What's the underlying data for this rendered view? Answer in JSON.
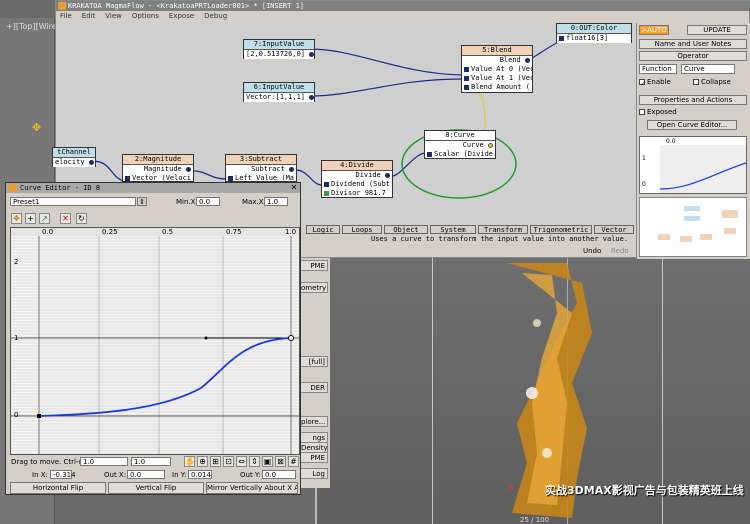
{
  "viewport": {
    "label": "+][Top][Wire"
  },
  "magma_flow": {
    "title": "KRAKATOA MagmaFlow - <KrakatoaPRTLoader001> * [INSERT 1]",
    "menu": [
      "File",
      "Edit",
      "View",
      "Options",
      "Expose",
      "Debug"
    ],
    "nodes": {
      "n7": {
        "title": "7:InputValue",
        "value": "[2,0.513726,0]"
      },
      "n6": {
        "title": "6:InputValue",
        "value": "Vector:[1,1,1]"
      },
      "n5": {
        "title": "5:Blend",
        "out": "Blend",
        "in1": "Value At 0 (Vec",
        "in2": "Value At 1 (Vec",
        "in3": "Blend Amount ("
      },
      "n0": {
        "title": "0:OUT:Color",
        "in": "float16[3]"
      },
      "n8": {
        "title": "8:Curve",
        "out": "Curve",
        "in": "Scalar (Divide."
      },
      "n4": {
        "title": "4:Divide",
        "out": "Divide",
        "in1": "Dividend (Subt",
        "in2": "Divisor 981.7"
      },
      "n3": {
        "title": "3:Subtract",
        "out": "Subtract",
        "in1": "Left Value (Ma"
      },
      "n2": {
        "title": "2:Magnitude",
        "out": "Magnitude",
        "in1": "Vector (Veloci"
      },
      "n1": {
        "title": "tChannel",
        "out": "elocity"
      }
    },
    "tabs": [
      "Logic",
      "Loops",
      "Object",
      "System",
      "Transform",
      "Trigonometric",
      "Vector"
    ],
    "description": "Uses a curve to transform the input value into another value.",
    "undo": "Undo",
    "redo": "Redo"
  },
  "right_panel": {
    "auto_btn": ">AUTO",
    "update_btn": "UPDATE",
    "name_notes": "Name and User Notes",
    "operator": "Operator",
    "function_sel": "Function",
    "curve_sel": "Curve",
    "enable": "Enable",
    "collapse": "Collapse",
    "props_actions": "Properties and Actions",
    "exposed": "Exposed",
    "open_curve_editor": "Open Curve Editor...",
    "mini_axis": [
      "0.0",
      "1",
      "0"
    ]
  },
  "curve_editor": {
    "title": "Curve Editor - ID 8",
    "preset": "Preset1",
    "min_x_label": "Min.X:",
    "min_x": "0.0",
    "max_x_label": "Max.X:",
    "max_x": "1.0",
    "x_ticks": [
      "0.0",
      "0.25",
      "0.5",
      "0.75",
      "1.0"
    ],
    "y_ticks": [
      "2",
      "1",
      "0"
    ],
    "status": "Drag to move. Ctrl-clk",
    "status_val1": "1.0",
    "status_val2": "1.0",
    "in_x_label": "In X:",
    "in_x": "-0.314",
    "out_x_label": "Out X:",
    "out_x": "0.0",
    "in_y_label": "In Y:",
    "in_y": "0.014",
    "out_y_label": "Out Y:",
    "out_y": "0.0",
    "btn_hflip": "Horizontal Flip",
    "btn_vflip": "Vertical Flip",
    "btn_mirror": "Mirror Vertically About X Axis"
  },
  "cmd_panel": [
    "PME",
    "ometry",
    "[full]",
    "DER",
    "plore...",
    "ngs",
    "Density",
    "PME",
    "Log"
  ],
  "watermark": "实战3DMAX影视广告与包装精英班上线",
  "frame": "25 / 100"
}
